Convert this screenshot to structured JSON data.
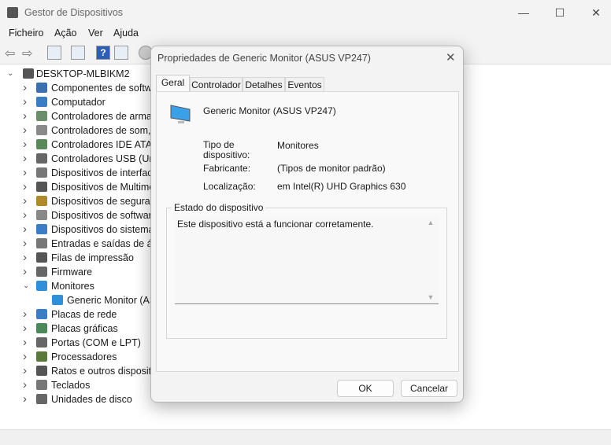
{
  "window": {
    "title": "Gestor de Dispositivos",
    "minimize": "—",
    "maximize": "☐",
    "close": "✕"
  },
  "menu": [
    "Ficheiro",
    "Ação",
    "Ver",
    "Ajuda"
  ],
  "tree": {
    "root": "DESKTOP-MLBIKM2",
    "items": [
      {
        "label": "Componentes de softwa",
        "expanded": false,
        "color": "#3a6fb0"
      },
      {
        "label": "Computador",
        "expanded": false,
        "color": "#3b7dc4"
      },
      {
        "label": "Controladores de armaz",
        "expanded": false,
        "color": "#6b8e6b"
      },
      {
        "label": "Controladores de som, v",
        "expanded": false,
        "color": "#8a8a8a"
      },
      {
        "label": "Controladores IDE ATA/A",
        "expanded": false,
        "color": "#5a8a5a"
      },
      {
        "label": "Controladores USB (Univ",
        "expanded": false,
        "color": "#666666"
      },
      {
        "label": "Dispositivos de interface",
        "expanded": false,
        "color": "#777777"
      },
      {
        "label": "Dispositivos de Multimé",
        "expanded": false,
        "color": "#555555"
      },
      {
        "label": "Dispositivos de seguran",
        "expanded": false,
        "color": "#b08a2a"
      },
      {
        "label": "Dispositivos de software",
        "expanded": false,
        "color": "#888888"
      },
      {
        "label": "Dispositivos do sistema",
        "expanded": false,
        "color": "#3b7dc4"
      },
      {
        "label": "Entradas e saídas de áud",
        "expanded": false,
        "color": "#777777"
      },
      {
        "label": "Filas de impressão",
        "expanded": false,
        "color": "#555555"
      },
      {
        "label": "Firmware",
        "expanded": false,
        "color": "#666666"
      },
      {
        "label": "Monitores",
        "expanded": true,
        "color": "#2f8fd8"
      },
      {
        "label": "Generic Monitor (AS",
        "child": true,
        "color": "#2f8fd8"
      },
      {
        "label": "Placas de rede",
        "expanded": false,
        "color": "#3b7dc4"
      },
      {
        "label": "Placas gráficas",
        "expanded": false,
        "color": "#4a8a5a"
      },
      {
        "label": "Portas (COM e LPT)",
        "expanded": false,
        "color": "#666666"
      },
      {
        "label": "Processadores",
        "expanded": false,
        "color": "#5a7a3a"
      },
      {
        "label": "Ratos e outros dispositiv",
        "expanded": false,
        "color": "#555555"
      },
      {
        "label": "Teclados",
        "expanded": false,
        "color": "#777777"
      },
      {
        "label": "Unidades de disco",
        "expanded": false,
        "color": "#666666"
      }
    ]
  },
  "dialog": {
    "title": "Propriedades de Generic Monitor (ASUS VP247)",
    "close": "✕",
    "tabs": [
      "Geral",
      "Controlador",
      "Detalhes",
      "Eventos"
    ],
    "active_tab": "Geral",
    "device_name": "Generic Monitor (ASUS VP247)",
    "props": [
      {
        "label": "Tipo de\ndispositivo:",
        "value": "Monitores"
      },
      {
        "label": "Fabricante:",
        "value": "(Tipos de monitor padrão)"
      },
      {
        "label": "Localização:",
        "value": "em Intel(R) UHD Graphics 630"
      }
    ],
    "status_group": "Estado do dispositivo",
    "status_text": "Este dispositivo está a funcionar corretamente.",
    "ok": "OK",
    "cancel": "Cancelar"
  }
}
